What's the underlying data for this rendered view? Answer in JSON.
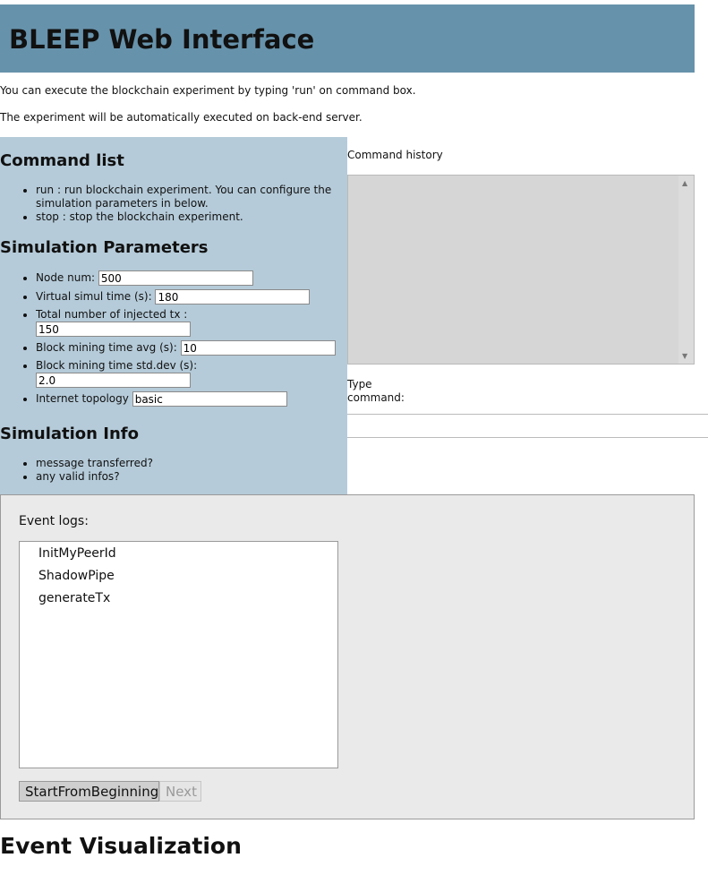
{
  "header": {
    "title": "BLEEP Web Interface"
  },
  "intro": {
    "line1": "You can execute the blockchain experiment by typing 'run' on command box.",
    "line2": "The experiment will be automatically executed on back-end server."
  },
  "command_list": {
    "title": "Command list",
    "items": [
      "run : run blockchain experiment. You can configure the simulation parameters in below.",
      "stop : stop the blockchain experiment."
    ]
  },
  "sim_params": {
    "title": "Simulation Parameters",
    "node_num": {
      "label": "Node num:",
      "value": "500"
    },
    "virtual_time": {
      "label": "Virtual simul time (s):",
      "value": "180"
    },
    "injected_tx": {
      "label": "Total number of injected tx :",
      "value": "150"
    },
    "mining_avg": {
      "label": "Block mining time avg (s):",
      "value": "10"
    },
    "mining_std": {
      "label": "Block mining time std.dev (s):",
      "value": "2.0"
    },
    "topology": {
      "label": "Internet topology",
      "value": "basic"
    }
  },
  "sim_info": {
    "title": "Simulation Info",
    "items": [
      "message transferred?",
      "any valid infos?"
    ]
  },
  "history": {
    "label": "Command history"
  },
  "command": {
    "label": "Type command:"
  },
  "events": {
    "title": "Event logs:",
    "logs": [
      "InitMyPeerId",
      "ShadowPipe",
      "generateTx"
    ],
    "start_label": "StartFromBeginning",
    "next_label": "Next"
  },
  "visualization": {
    "title": "Event Visualization"
  }
}
